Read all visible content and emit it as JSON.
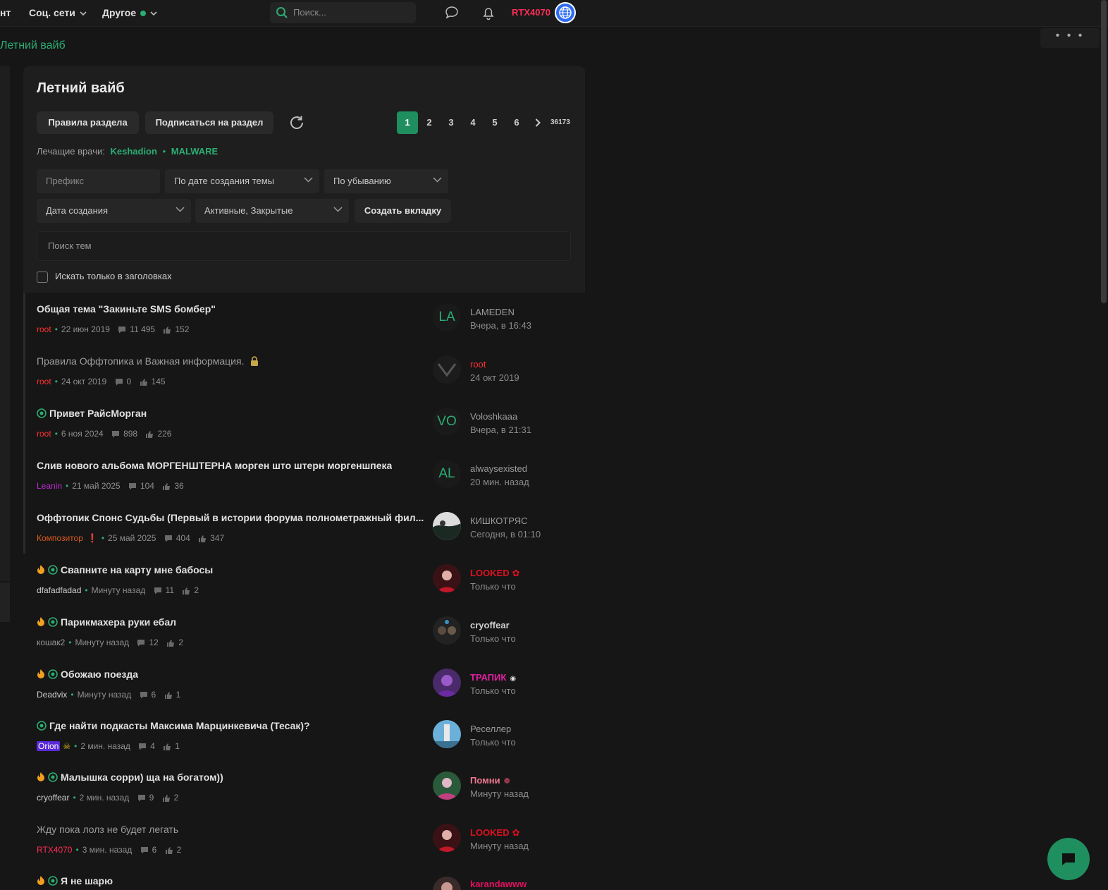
{
  "topbar": {
    "nav": [
      {
        "label": "нт"
      },
      {
        "label": "Соц. сети"
      },
      {
        "label": "Другое"
      }
    ],
    "search_placeholder": "Поиск...",
    "username": "RTX4070"
  },
  "breadcrumb": "Летний вайб",
  "forum": {
    "title": "Летний вайб",
    "rules_button": "Правила раздела",
    "subscribe_button": "Подписаться на раздел",
    "pagination": {
      "pages": [
        "1",
        "2",
        "3",
        "4",
        "5",
        "6"
      ],
      "active": "1",
      "last": "36173"
    },
    "doctors_label": "Лечащие врачи:",
    "doctors": [
      "Keshadion",
      "MALWARE"
    ],
    "filters": {
      "prefix": "Префикс",
      "sort": "По дате создания темы",
      "order": "По убыванию",
      "date": "Дата создания",
      "state": "Активные, Закрытые",
      "create_tab": "Создать вкладку"
    },
    "search_threads_placeholder": "Поиск тем",
    "title_only_label": "Искать только в заголовках"
  },
  "threads": [
    {
      "title": "Общая тема \"Закиньте SMS бомбер\"",
      "author": "root",
      "date": "22 июн 2019",
      "replies": "11 495",
      "likes": "152",
      "last_user": "LAMEDEN",
      "last_time": "Вчера, в 16:43",
      "avatar_text": "LA"
    },
    {
      "title": "Правила Оффтопика и Важная информация.",
      "author": "root",
      "date": "24 окт 2019",
      "replies": "0",
      "likes": "145",
      "last_user": "root",
      "last_time": "24 окт 2019",
      "avatar_text": ""
    },
    {
      "title": "Привет РайсМорган",
      "author": "root",
      "date": "6 ноя 2024",
      "replies": "898",
      "likes": "226",
      "last_user": "Voloshkaaa",
      "last_time": "Вчера, в 21:31",
      "avatar_text": "VO"
    },
    {
      "title": "Слив нового альбома МОРГЕНШТЕРНА морген што штерн моргеншпека",
      "author": "Leanin",
      "date": "21 май 2025",
      "replies": "104",
      "likes": "36",
      "last_user": "alwaysexisted",
      "last_time": "20 мин. назад",
      "avatar_text": "AL"
    },
    {
      "title": "Оффтопик Спонс Судьбы (Первый в истории форума полнометражный фил...",
      "author": "Композитор",
      "date": "25 май 2025",
      "replies": "404",
      "likes": "347",
      "last_user": "КИШКОТРЯС",
      "last_time": "Сегодня, в 01:10",
      "avatar_text": ""
    },
    {
      "title": "Свапните на карту мне бабосы",
      "author": "dfafadfadad",
      "date": "Минуту назад",
      "replies": "11",
      "likes": "2",
      "last_user": "LOOKED",
      "last_time": "Только что",
      "avatar_text": ""
    },
    {
      "title": "Парикмахера руки ебал",
      "author": "кошак2",
      "date": "Минуту назад",
      "replies": "12",
      "likes": "2",
      "last_user": "cryoffear",
      "last_time": "Только что",
      "avatar_text": ""
    },
    {
      "title": "Обожаю поезда",
      "author": "Deadvix",
      "date": "Минуту назад",
      "replies": "6",
      "likes": "1",
      "last_user": "ТРАПИК",
      "last_time": "Только что",
      "avatar_text": ""
    },
    {
      "title": "Где найти подкасты Максима Марцинкевича (Тесак)?",
      "author": "Orion",
      "date": "2 мин. назад",
      "replies": "4",
      "likes": "1",
      "last_user": "Реселлер",
      "last_time": "Только что",
      "avatar_text": ""
    },
    {
      "title": "Малышка сорри) ща на богатом))",
      "author": "cryoffear",
      "date": "2 мин. назад",
      "replies": "9",
      "likes": "2",
      "last_user": "Помни",
      "last_time": "Минуту назад",
      "avatar_text": ""
    },
    {
      "title": "Жду пока лолз не будет легать",
      "author": "RTX4070",
      "date": "3 мин. назад",
      "replies": "6",
      "likes": "2",
      "last_user": "LOOKED",
      "last_time": "Минуту назад",
      "avatar_text": ""
    },
    {
      "title": "Я не шарю",
      "author": "",
      "date": "",
      "replies": "",
      "likes": "",
      "last_user": "karandawww",
      "last_time": "",
      "avatar_text": ""
    }
  ],
  "colors": {
    "accent": "#2bad72",
    "background": "#161616",
    "panel": "#1e1e1e",
    "username_red": "#ff2d55"
  }
}
